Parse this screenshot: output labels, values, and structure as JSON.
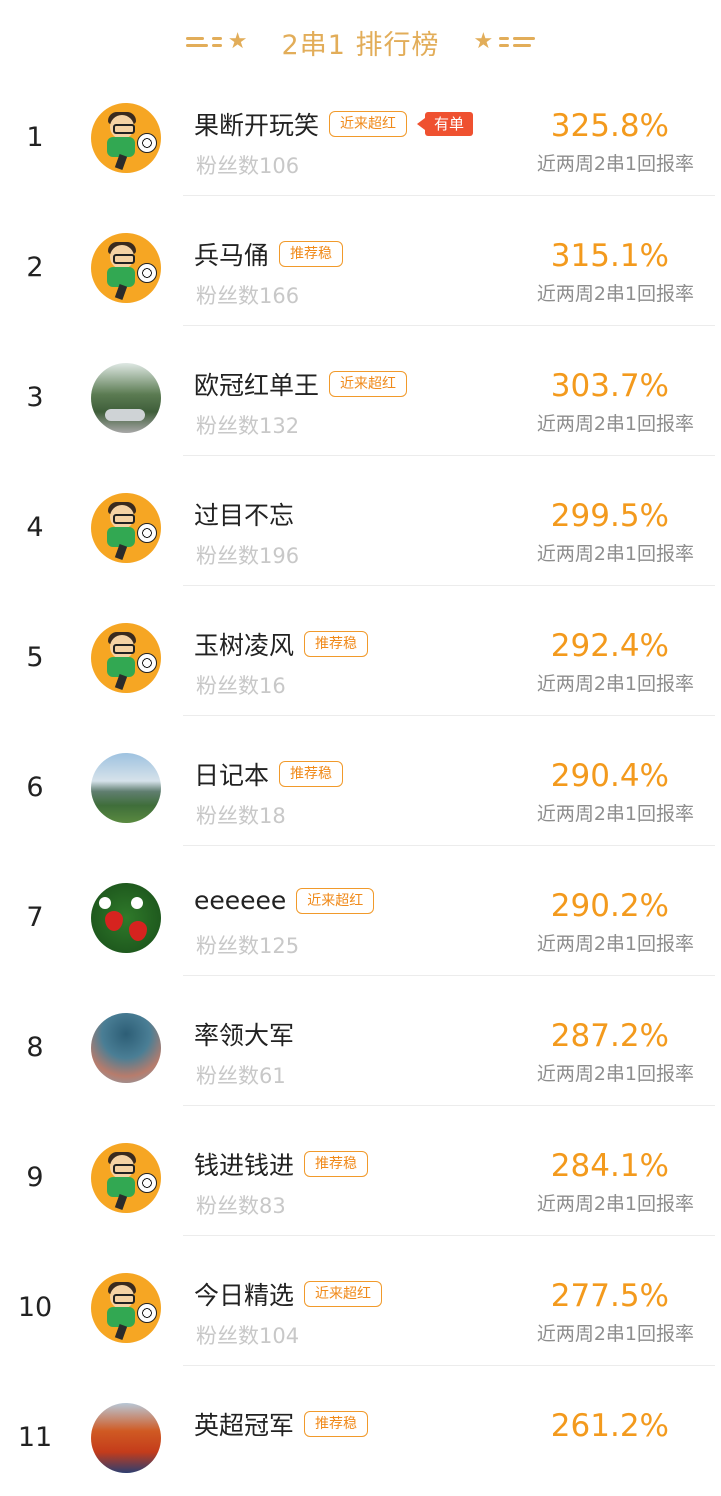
{
  "header": {
    "title": "2串1 排行榜",
    "accent_color": "#e2ad59"
  },
  "rate_label": "近两周2串1回报率",
  "colors": {
    "rate": "#f39a1d",
    "tag_border": "#f19a2b",
    "youdan_bg": "#ef5130"
  },
  "rows": [
    {
      "rank": "1",
      "name": "果断开玩笑",
      "tag": "近来超红",
      "badge": "有单",
      "fans": "粉丝数106",
      "rate": "325.8%",
      "avatar": "cartoon-soccer-icon"
    },
    {
      "rank": "2",
      "name": "兵马俑",
      "tag": "推荐稳",
      "badge": "",
      "fans": "粉丝数166",
      "rate": "315.1%",
      "avatar": "cartoon-soccer-icon"
    },
    {
      "rank": "3",
      "name": "欧冠红单王",
      "tag": "近来超红",
      "badge": "",
      "fans": "粉丝数132",
      "rate": "303.7%",
      "avatar": "street-photo"
    },
    {
      "rank": "4",
      "name": "过目不忘",
      "tag": "",
      "badge": "",
      "fans": "粉丝数196",
      "rate": "299.5%",
      "avatar": "cartoon-soccer-icon"
    },
    {
      "rank": "5",
      "name": "玉树凌风",
      "tag": "推荐稳",
      "badge": "",
      "fans": "粉丝数16",
      "rate": "292.4%",
      "avatar": "cartoon-soccer-icon"
    },
    {
      "rank": "6",
      "name": "日记本",
      "tag": "推荐稳",
      "badge": "",
      "fans": "粉丝数18",
      "rate": "290.4%",
      "avatar": "lake-photo"
    },
    {
      "rank": "7",
      "name": "eeeeee",
      "tag": "近来超红",
      "badge": "",
      "fans": "粉丝数125",
      "rate": "290.2%",
      "avatar": "strawberry-photo"
    },
    {
      "rank": "8",
      "name": "率领大军",
      "tag": "",
      "badge": "",
      "fans": "粉丝数61",
      "rate": "287.2%",
      "avatar": "planet-photo"
    },
    {
      "rank": "9",
      "name": "钱进钱进",
      "tag": "推荐稳",
      "badge": "",
      "fans": "粉丝数83",
      "rate": "284.1%",
      "avatar": "cartoon-soccer-icon"
    },
    {
      "rank": "10",
      "name": "今日精选",
      "tag": "近来超红",
      "badge": "",
      "fans": "粉丝数104",
      "rate": "277.5%",
      "avatar": "cartoon-soccer-icon"
    },
    {
      "rank": "11",
      "name": "英超冠军",
      "tag": "推荐稳",
      "badge": "",
      "fans": "",
      "rate": "261.2%",
      "avatar": "player-photo"
    }
  ]
}
